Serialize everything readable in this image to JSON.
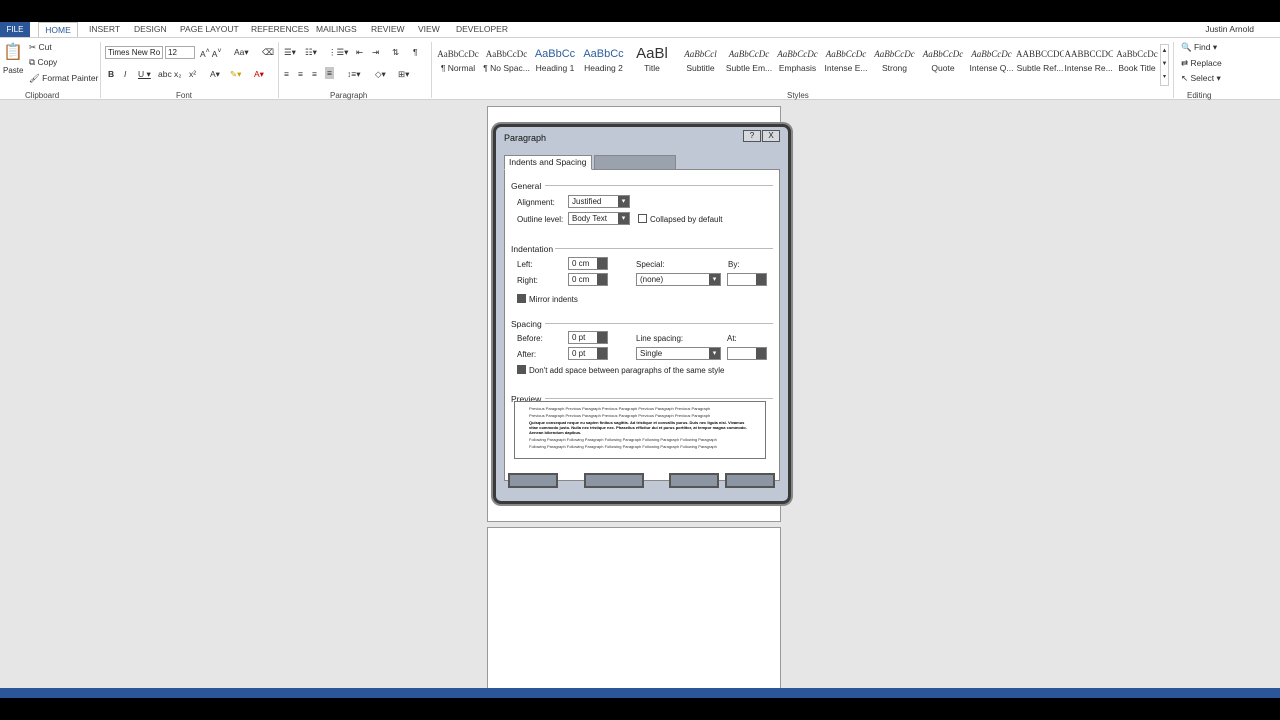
{
  "ribbon_tabs": [
    "FILE",
    "HOME",
    "INSERT",
    "DESIGN",
    "PAGE LAYOUT",
    "REFERENCES",
    "MAILINGS",
    "REVIEW",
    "VIEW",
    "DEVELOPER"
  ],
  "user": "Justin Arnold",
  "clipboard": {
    "paste": "Paste",
    "cut": "Cut",
    "copy": "Copy",
    "format_painter": "Format Painter",
    "label": "Clipboard"
  },
  "font": {
    "name": "Times New Ro",
    "size": "12",
    "label": "Font"
  },
  "paragraph_group_label": "Paragraph",
  "styles": {
    "label": "Styles",
    "items": [
      {
        "preview": "AaBbCcDc",
        "label": "¶ Normal"
      },
      {
        "preview": "AaBbCcDc",
        "label": "¶ No Spac..."
      },
      {
        "preview": "AaBbCc",
        "label": "Heading 1"
      },
      {
        "preview": "AaBbCc",
        "label": "Heading 2"
      },
      {
        "preview": "AaBl",
        "label": "Title"
      },
      {
        "preview": "AaBbCcl",
        "label": "Subtitle"
      },
      {
        "preview": "AaBbCcDc",
        "label": "Subtle Em..."
      },
      {
        "preview": "AaBbCcDc",
        "label": "Emphasis"
      },
      {
        "preview": "AaBbCcDc",
        "label": "Intense E..."
      },
      {
        "preview": "AaBbCcDc",
        "label": "Strong"
      },
      {
        "preview": "AaBbCcDc",
        "label": "Quote"
      },
      {
        "preview": "AaBbCcDc",
        "label": "Intense Q..."
      },
      {
        "preview": "AABBCCDC",
        "label": "Subtle Ref..."
      },
      {
        "preview": "AABBCCDC",
        "label": "Intense Re..."
      },
      {
        "preview": "AaBbCcDc",
        "label": "Book Title"
      }
    ]
  },
  "editing": {
    "find": "Find",
    "replace": "Replace",
    "select": "Select",
    "label": "Editing"
  },
  "dialog": {
    "title": "Paragraph",
    "help": "?",
    "close": "X",
    "tab_active": "Indents and Spacing",
    "general_label": "General",
    "alignment_label": "Alignment:",
    "alignment_value": "Justified",
    "outline_label": "Outline level:",
    "outline_value": "Body Text",
    "collapsed_label": "Collapsed by default",
    "indentation_label": "Indentation",
    "left_label": "Left:",
    "left_value": "0 cm",
    "right_label": "Right:",
    "right_value": "0 cm",
    "special_label": "Special:",
    "special_value": "(none)",
    "by_label": "By:",
    "mirror_label": "Mirror indents",
    "spacing_label": "Spacing",
    "before_label": "Before:",
    "before_value": "0 pt",
    "after_label": "After:",
    "after_value": "0 pt",
    "line_spacing_label": "Line spacing:",
    "line_spacing_value": "Single",
    "at_label": "At:",
    "dont_add_label": "Don't add space between paragraphs of the same style",
    "preview_label": "Preview",
    "preview_text": [
      "Previous Paragraph Previous Paragraph Previous Paragraph Previous Paragraph Previous Paragraph",
      "Previous Paragraph Previous Paragraph Previous Paragraph Previous Paragraph Previous Paragraph",
      "Quisque consequat neque eu sapien finibus sagittis. Ad tristique et convallis purus. Duis nec ligula nisi. Vivamus vitae commodo justo. Nulla nec tristique nec. Phasellus efficitur dui et purus porttitor, at tempor magna commodo. Aenean bibendum dapibus.",
      "Following Paragraph Following Paragraph Following Paragraph Following Paragraph Following Paragraph",
      "Following Paragraph Following Paragraph Following Paragraph Following Paragraph Following Paragraph"
    ]
  }
}
